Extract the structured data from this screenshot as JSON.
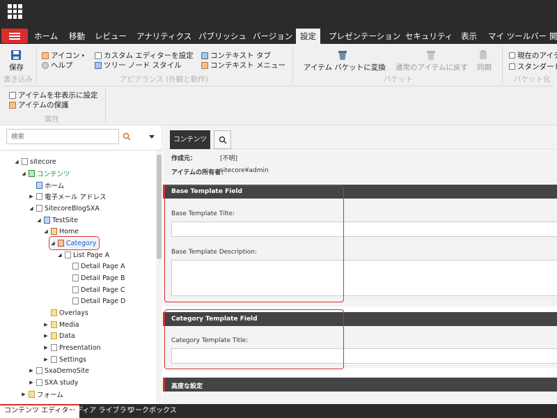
{
  "ribbon_tabs": [
    "ホーム",
    "移動",
    "レビュー",
    "アナリティクス",
    "パブリッシュ",
    "バージョン",
    "設定",
    "プレゼンテーション",
    "セキュリティ",
    "表示",
    "マイ ツールバー",
    "開"
  ],
  "active_tab": "設定",
  "ribbon": {
    "save_label": "保存",
    "write_group_label": "書き込み",
    "icon_label": "アイコン",
    "help_label": "ヘルプ",
    "custom_editor_label": "カスタム エディターを設定",
    "tree_node_style_label": "ツリー ノード スタイル",
    "context_tab_label": "コンテキスト タブ",
    "context_menu_label": "コンテキスト メニュー",
    "appearance_group_label": "アピアランス (外観と動作)",
    "convert_bucket_label": "アイテム バケットに変換",
    "revert_item_label": "通常のアイテムに戻す",
    "sync_label": "同期",
    "bucket_group_label": "バケット",
    "current_item_label": "現在のアイテ",
    "standard_label": "スタンダード",
    "bucketable_group_label": "バケット化",
    "hide_item_label": "アイテムを非表示に設定",
    "protect_item_label": "アイテムの保護",
    "attributes_group_label": "属性"
  },
  "search": {
    "placeholder": "検索"
  },
  "tree": [
    {
      "label": "sitecore",
      "expander": "◢",
      "icon": "page"
    },
    {
      "label": "コンテンツ",
      "expander": "◢",
      "icon": "green"
    },
    {
      "label": "ホーム",
      "expander": "",
      "icon": "site"
    },
    {
      "label": "電子メール アドレス",
      "expander": "▶",
      "icon": "page"
    },
    {
      "label": "SitecoreBlogSXA",
      "expander": "◢",
      "icon": "page"
    },
    {
      "label": "TestSite",
      "expander": "◢",
      "icon": "site"
    },
    {
      "label": "Home",
      "expander": "◢",
      "icon": "home"
    },
    {
      "label": "Category",
      "expander": "◢",
      "icon": "cat"
    },
    {
      "label": "List Page A",
      "expander": "◢",
      "icon": "page"
    },
    {
      "label": "Detail Page A",
      "expander": "",
      "icon": "page"
    },
    {
      "label": "Detail Page B",
      "expander": "",
      "icon": "page"
    },
    {
      "label": "Detail Page C",
      "expander": "",
      "icon": "page"
    },
    {
      "label": "Detail Page D",
      "expander": "",
      "icon": "page"
    },
    {
      "label": "Overlays",
      "expander": "",
      "icon": "folder"
    },
    {
      "label": "Media",
      "expander": "▶",
      "icon": "folder"
    },
    {
      "label": "Data",
      "expander": "▶",
      "icon": "folder"
    },
    {
      "label": "Presentation",
      "expander": "▶",
      "icon": "page"
    },
    {
      "label": "Settings",
      "expander": "▶",
      "icon": "page"
    },
    {
      "label": "SxaDemoSite",
      "expander": "▶",
      "icon": "page"
    },
    {
      "label": "SXA study",
      "expander": "▶",
      "icon": "page"
    },
    {
      "label": "フォーム",
      "expander": "▶",
      "icon": "folder"
    }
  ],
  "content": {
    "tab_label": "コンテンツ",
    "created_from_label": "作成元：",
    "created_from_value": "[不明]",
    "owner_label": "アイテムの所有者：",
    "owner_value": "sitecore¥admin",
    "base_section_title": "Base Template Field",
    "base_title_label": "Base Template Tilte:",
    "base_title_value": "",
    "base_desc_label": "Base Template Description:",
    "base_desc_value": "",
    "category_section_title": "Category Template Field",
    "category_title_label": "Category Template Title:",
    "category_title_value": "",
    "advanced_section_title": "高度な設定"
  },
  "bottom_tabs": [
    "コンテンツ エディター",
    "メディア ライブラリ",
    "ワークボックス"
  ],
  "colors": {
    "accent": "#d92d2d",
    "dark": "#2b2b2b",
    "link": "#1a5fb4"
  }
}
